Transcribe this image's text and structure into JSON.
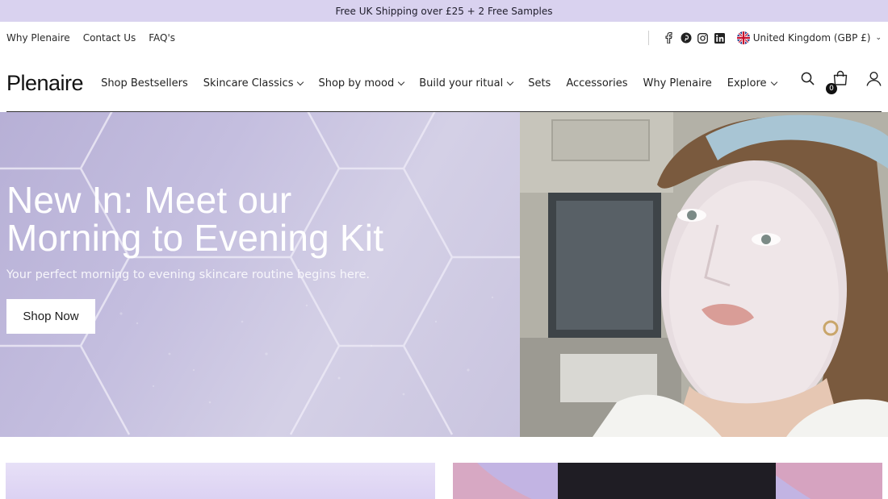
{
  "announcement": {
    "text": "Free UK Shipping over £25 + 2 Free Samples"
  },
  "utility": {
    "links": [
      "Why Plenaire",
      "Contact Us",
      "FAQ's"
    ],
    "social_icons": [
      "facebook-icon",
      "pinterest-icon",
      "instagram-icon",
      "linkedin-icon"
    ],
    "currency": "United Kingdom (GBP £)"
  },
  "nav": {
    "logo": "Plenaire",
    "items": [
      {
        "label": "Shop Bestsellers",
        "dropdown": false
      },
      {
        "label": "Skincare Classics",
        "dropdown": true
      },
      {
        "label": "Shop by mood",
        "dropdown": true
      },
      {
        "label": "Build your ritual",
        "dropdown": true
      },
      {
        "label": "Sets",
        "dropdown": false
      },
      {
        "label": "Accessories",
        "dropdown": false
      },
      {
        "label": "Why Plenaire",
        "dropdown": false
      },
      {
        "label": "Explore",
        "dropdown": true
      }
    ],
    "cart_count": "0",
    "icons": [
      "search-icon",
      "cart-icon",
      "account-icon"
    ]
  },
  "hero": {
    "title_line1": "New In: Meet our",
    "title_line2": "Morning to Evening Kit",
    "subtitle": "Your perfect morning to evening skincare routine begins here.",
    "cta": "Shop Now"
  },
  "colors": {
    "announcement_bg": "#d9d2ef",
    "hero_lavender": "#c4bedf",
    "accent_dark": "#111111"
  }
}
